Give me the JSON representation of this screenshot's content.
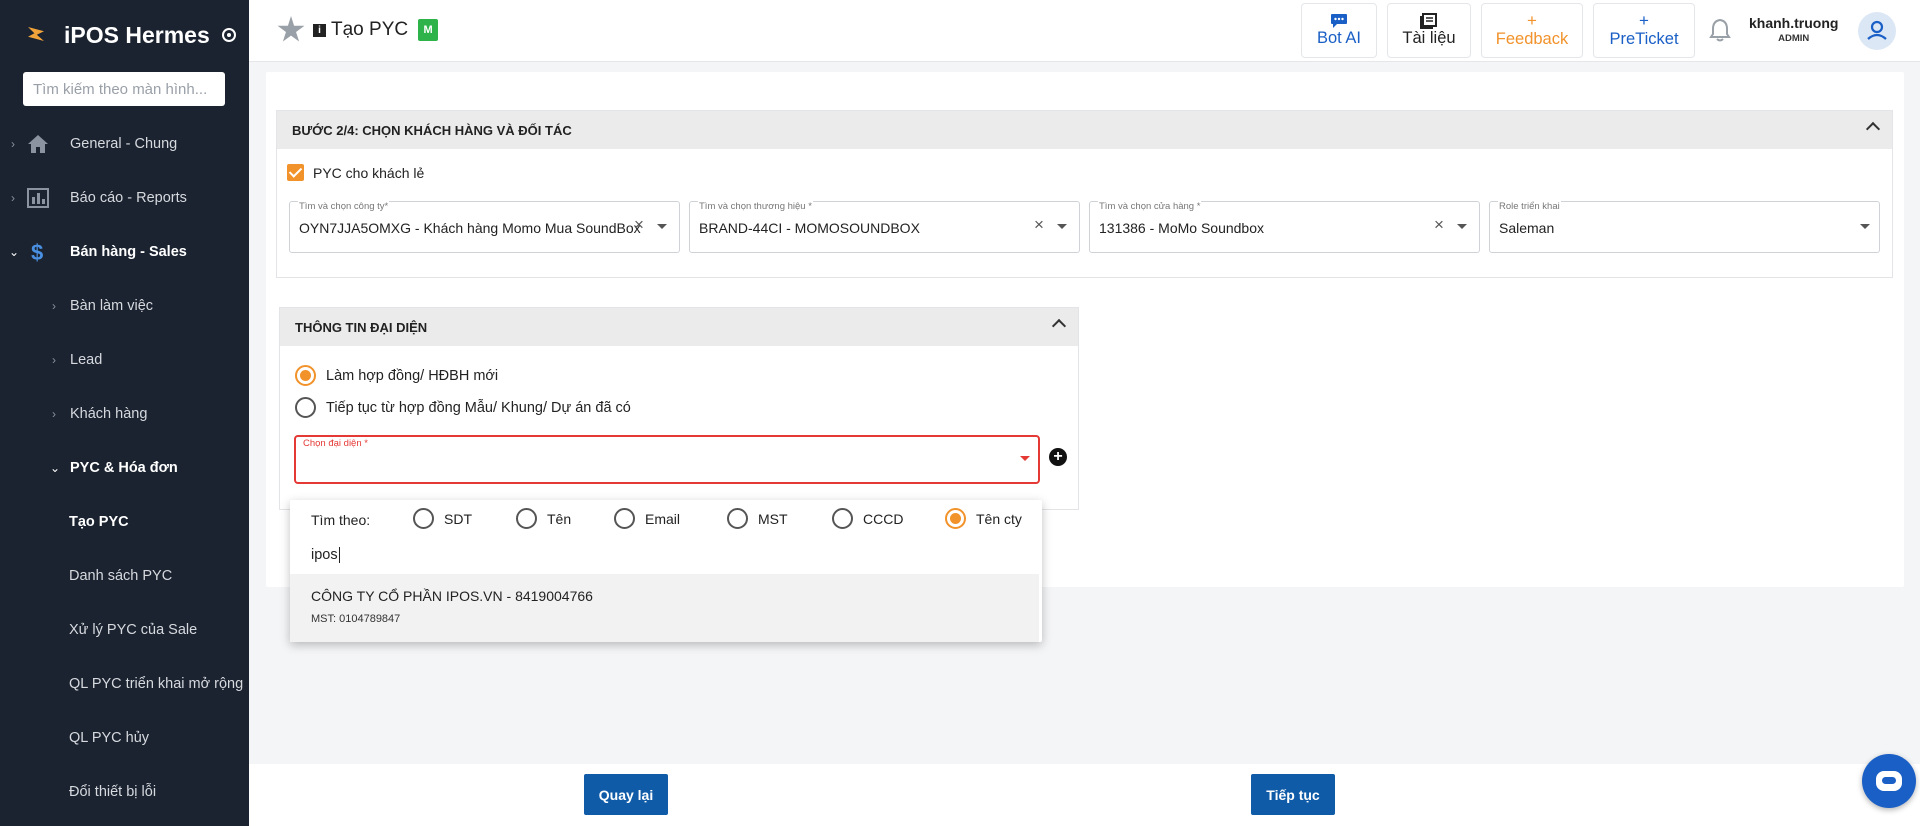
{
  "sidebar": {
    "brand": "iPOS Hermes",
    "search_placeholder": "Tìm kiếm theo màn hình...",
    "items": [
      {
        "label": "General - Chung"
      },
      {
        "label": "Báo cáo - Reports"
      },
      {
        "label": "Bán hàng - Sales"
      },
      {
        "label": "Bàn làm việc"
      },
      {
        "label": "Lead"
      },
      {
        "label": "Khách hàng"
      },
      {
        "label": "PYC & Hóa đơn"
      },
      {
        "label": "Tạo PYC"
      },
      {
        "label": "Danh sách PYC"
      },
      {
        "label": "Xử lý PYC của Sale"
      },
      {
        "label": "QL PYC triển khai mở rộng"
      },
      {
        "label": "QL PYC hủy"
      },
      {
        "label": "Đổi thiết bị lỗi"
      }
    ]
  },
  "header": {
    "title": "Tạo PYC",
    "badge": "M",
    "buttons": [
      {
        "label": "Bot AI",
        "color": "#1a5fc6"
      },
      {
        "label": "Tài liệu",
        "color": "#222222"
      },
      {
        "label": "Feedback",
        "color": "#f2922a",
        "icon": "+"
      },
      {
        "label": "PreTicket",
        "color": "#1a5fc6",
        "icon": "+"
      }
    ],
    "user": {
      "name": "khanh.truong",
      "role": "ADMIN"
    }
  },
  "step": {
    "title": "BƯỚC 2/4: CHỌN KHÁCH HÀNG VÀ ĐỐI TÁC",
    "checkbox_label": "PYC cho khách lẻ",
    "fields": [
      {
        "label": "Tìm và chọn công ty*",
        "value": "OYN7JJA5OMXG - Khách hàng Momo Mua SoundBox"
      },
      {
        "label": "Tìm và chọn thương hiệu *",
        "value": "BRAND-44CI - MOMOSOUNDBOX"
      },
      {
        "label": "Tìm và chọn cửa hàng *",
        "value": "131386 - MoMo Soundbox"
      },
      {
        "label": "Role triển khai",
        "value": "Saleman"
      }
    ]
  },
  "representative": {
    "title": "THÔNG TIN ĐẠI DIỆN",
    "radio_new": "Làm hợp đồng/ HĐBH mới",
    "radio_continue": "Tiếp tục từ hợp đồng Mẫu/ Khung/ Dự án đã có",
    "select_label": "Chọn đại diện *"
  },
  "popup": {
    "search_by_label": "Tìm theo:",
    "options": [
      {
        "label": "SDT"
      },
      {
        "label": "Tên"
      },
      {
        "label": "Email"
      },
      {
        "label": "MST"
      },
      {
        "label": "CCCD"
      },
      {
        "label": "Tên cty"
      }
    ],
    "query": "ipos",
    "result_name": "CÔNG TY CỔ PHẦN IPOS.VN - 8419004766",
    "result_tax": "MST: 0104789847"
  },
  "footer": {
    "back": "Quay lại",
    "next": "Tiếp tục"
  },
  "colors": {
    "sidebar_bg": "#1b2330",
    "accent_orange": "#f2922a",
    "primary_blue": "#0f5ba8",
    "error_red": "#e53935"
  }
}
